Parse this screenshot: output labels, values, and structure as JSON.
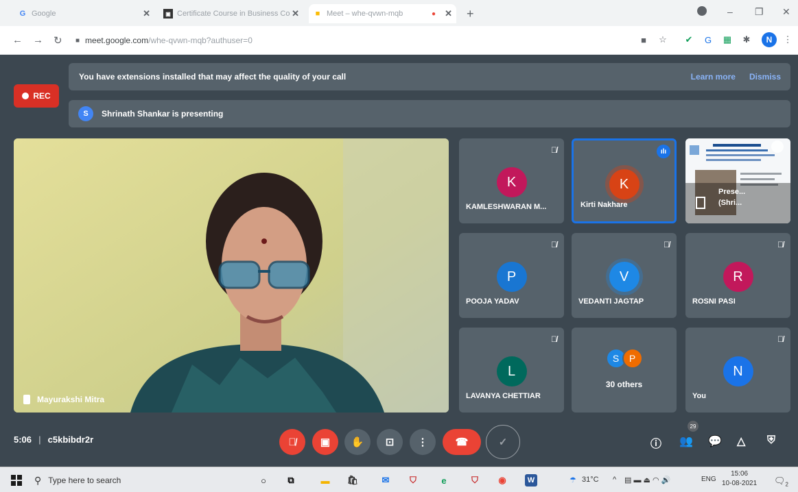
{
  "browser": {
    "tabs": [
      {
        "title": "Google",
        "favicon": "G"
      },
      {
        "title": "Certificate Course in Business Co",
        "favicon": "cert-icon"
      },
      {
        "title": "Meet – whe-qvwn-mqb",
        "favicon": "meet-icon"
      }
    ],
    "url_host": "meet.google.com",
    "url_path": "/whe-qvwn-mqb?authuser=0",
    "profile_initial": "N"
  },
  "meet": {
    "rec_label": "REC",
    "extension_warning": "You have extensions installed that may affect the quality of your call",
    "learn_more": "Learn more",
    "dismiss": "Dismiss",
    "presenter_initial": "S",
    "presenting_text": "Shrinath Shankar is presenting",
    "main_speaker": "Mayurakshi Mitra",
    "participants": [
      {
        "name": "KAMLESHWARAN M...",
        "initial": "K",
        "color": "#c2185b",
        "muted": true
      },
      {
        "name": "Kirti Nakhare",
        "initial": "K",
        "color": "#d84315",
        "muted": false,
        "speaking": true
      },
      {
        "name": "POOJA YADAV",
        "initial": "P",
        "color": "#1976d2",
        "muted": true
      },
      {
        "name": "VEDANTI JAGTAP",
        "initial": "V",
        "color": "#1e88e5",
        "muted": true
      },
      {
        "name": "ROSNI PASI",
        "initial": "R",
        "color": "#c2185b",
        "muted": true
      },
      {
        "name": "LAVANYA CHETTIAR",
        "initial": "L",
        "color": "#00695c",
        "muted": true
      },
      {
        "name": "You",
        "initial": "N",
        "color": "#1a73e8",
        "muted": true
      }
    ],
    "others": {
      "label": "30 others",
      "initials": [
        "S",
        "P"
      ],
      "colors": [
        "#1e88e5",
        "#ef6c00"
      ]
    },
    "presentation_tile": {
      "line1": "Prese...",
      "line2": "(Shri..."
    },
    "meeting_time": "5:06",
    "meeting_code": "c5kbibdr2r",
    "participant_count": "29"
  },
  "taskbar": {
    "search_placeholder": "Type here to search",
    "weather": "31°C",
    "language": "ENG",
    "time": "15:06",
    "date": "10-08-2021",
    "notification_count": "2"
  }
}
